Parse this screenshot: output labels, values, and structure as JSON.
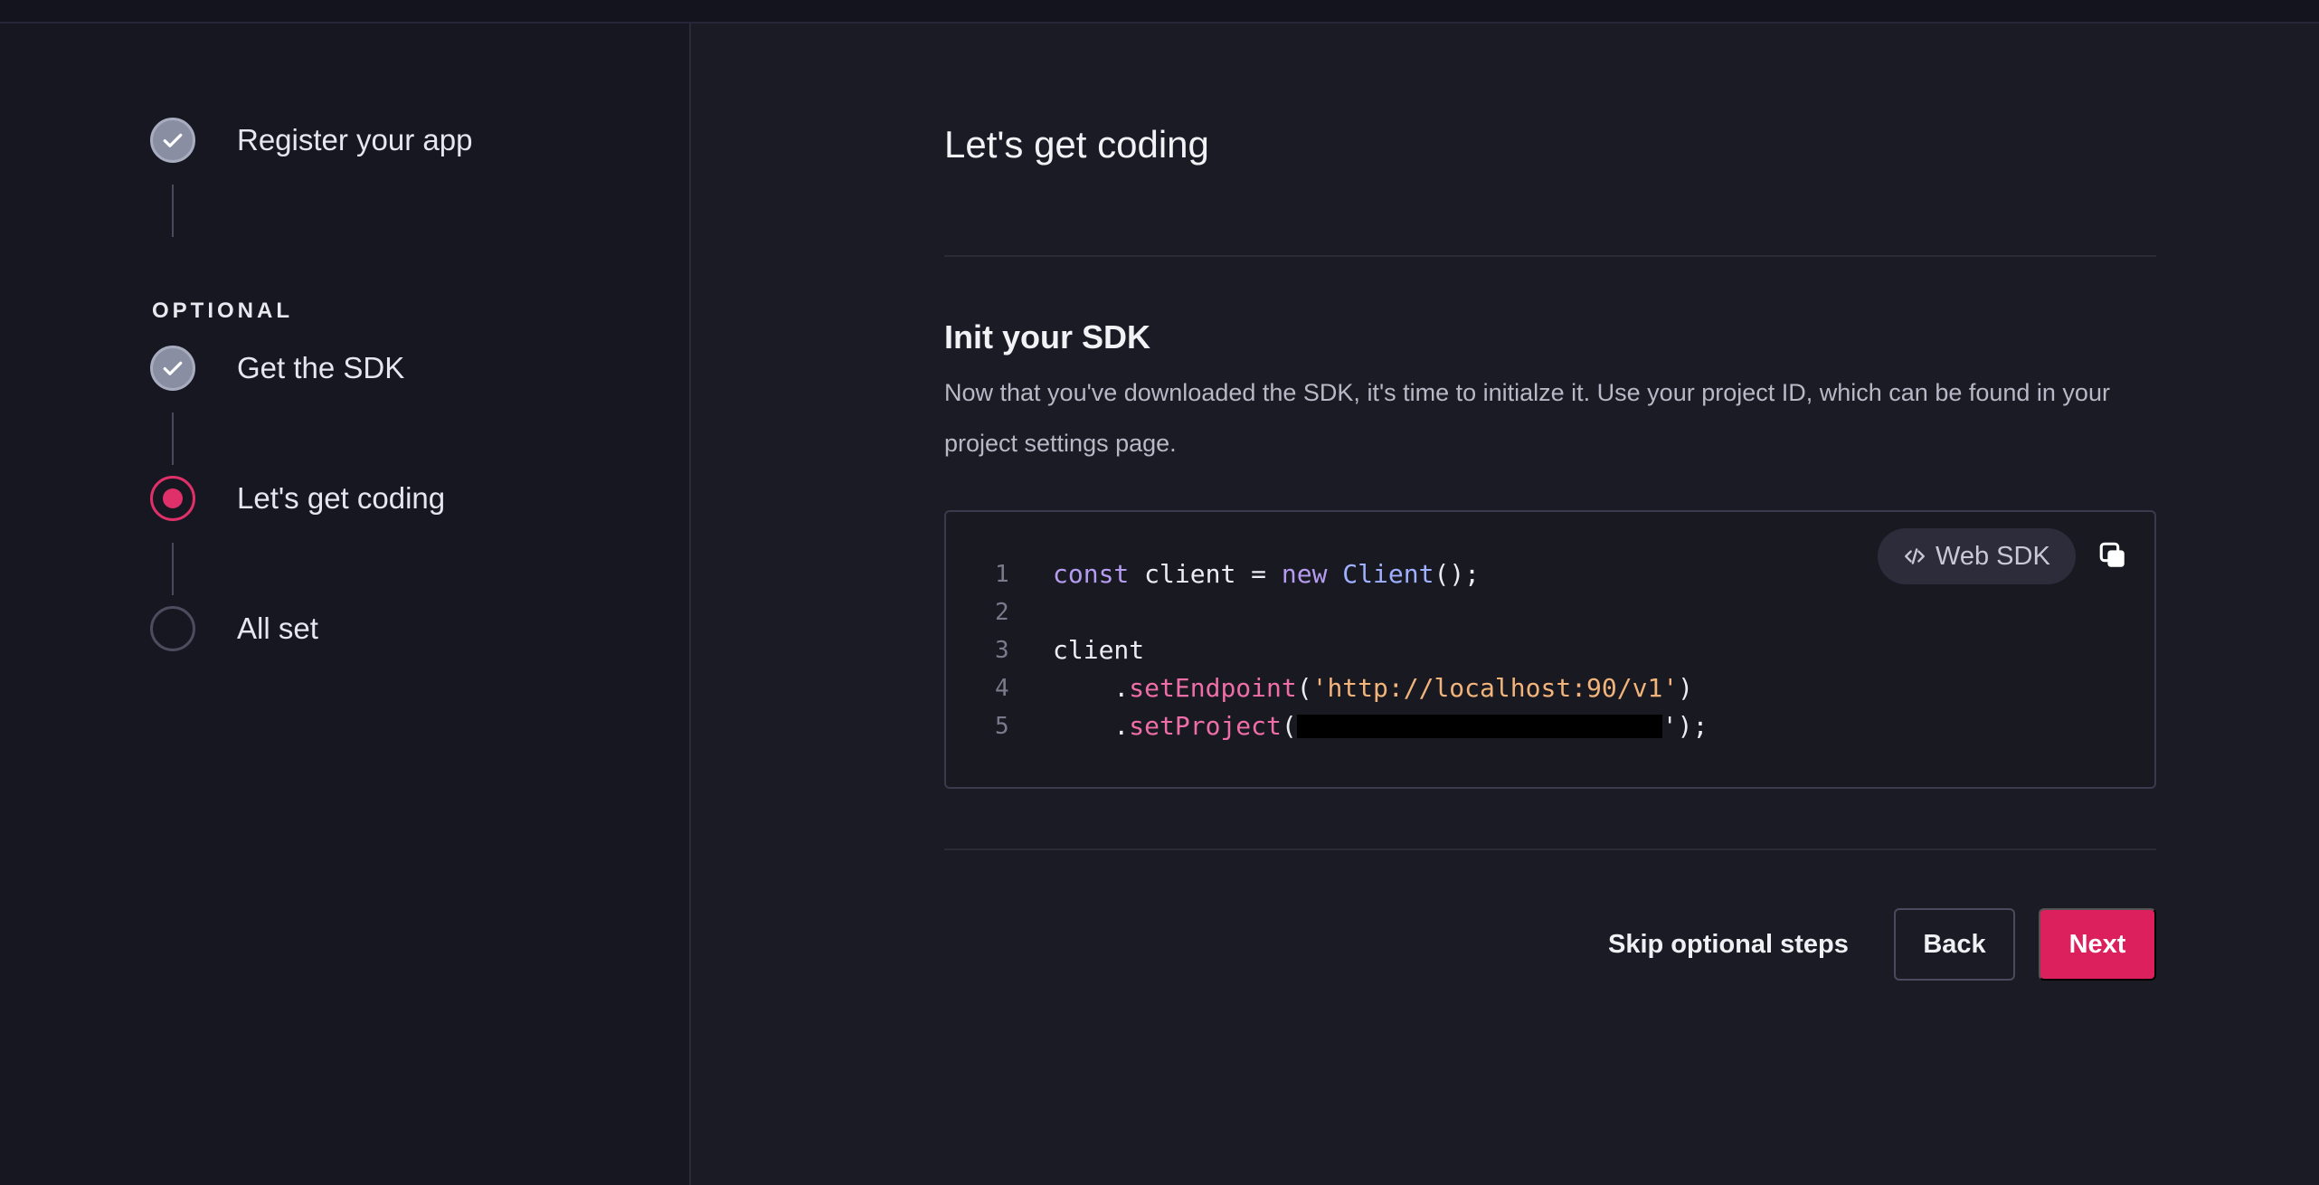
{
  "steps": [
    {
      "label": "Register your app",
      "status": "done"
    },
    {
      "label": "Get the SDK",
      "status": "done"
    },
    {
      "label": "Let's get coding",
      "status": "current"
    },
    {
      "label": "All set",
      "status": "todo"
    }
  ],
  "optional_label": "OPTIONAL",
  "page": {
    "title": "Let's get coding",
    "section_title": "Init your SDK",
    "description": "Now that you've downloaded the SDK, it's time to initialze it. Use your project ID, which can be found in your project settings page."
  },
  "code": {
    "badge_label": "Web SDK",
    "line_numbers": [
      "1",
      "2",
      "3",
      "4",
      "5"
    ],
    "line1": {
      "kw_const": "const",
      "var": " client = ",
      "kw_new": "new",
      "cls": " Client",
      "end": "();"
    },
    "line3": {
      "var": "client"
    },
    "line4": {
      "indent": "    .",
      "fn": "setEndpoint",
      "open": "(",
      "str": "'http://localhost:90/v1'",
      "close": ")"
    },
    "line5": {
      "indent": "    .",
      "fn": "setProject",
      "open": "(",
      "close": "');"
    }
  },
  "actions": {
    "skip": "Skip optional steps",
    "back": "Back",
    "next": "Next"
  },
  "colors": {
    "accent": "#dc1f5d",
    "background": "#1b1b25",
    "sidebar": "#171722"
  },
  "icons": {
    "done": "check-icon",
    "badge": "code-brackets-icon",
    "copy": "copy-icon"
  }
}
